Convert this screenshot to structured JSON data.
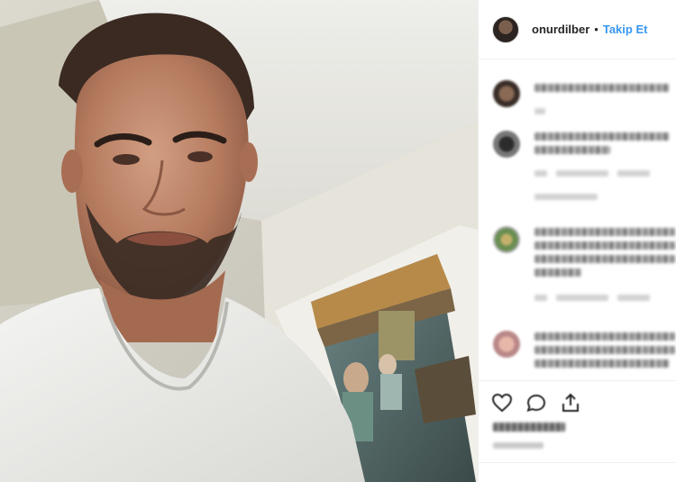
{
  "post": {
    "username": "onurdilber",
    "separator": "•",
    "follow_label": "Takip Et"
  },
  "icons": {
    "like": "heart-icon",
    "comment": "comment-icon",
    "share": "share-icon"
  },
  "colors": {
    "follow_blue": "#3897f0",
    "text": "#262626",
    "divider": "#efefef"
  }
}
